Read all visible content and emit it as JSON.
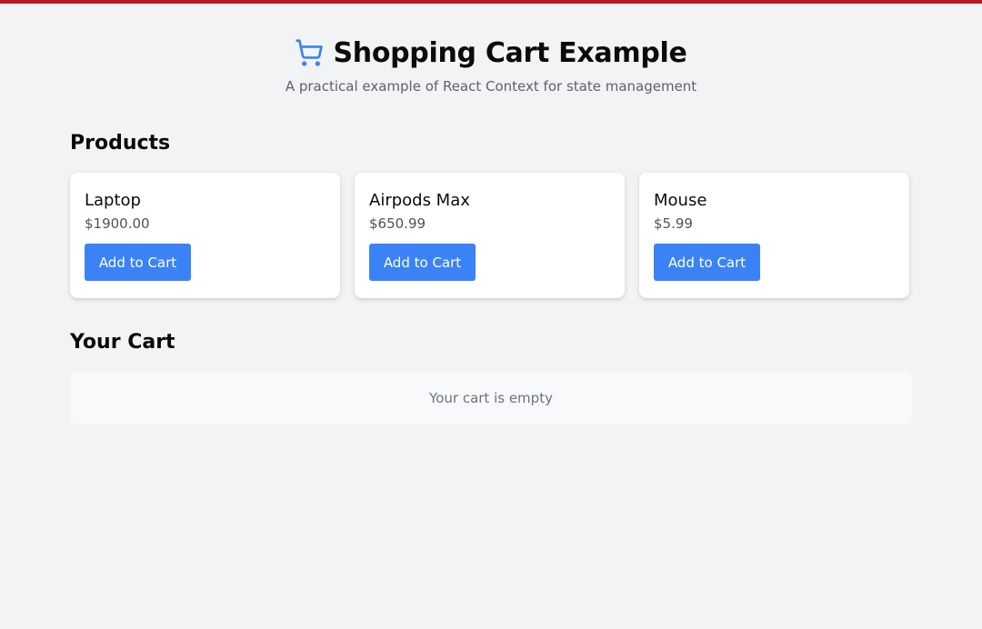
{
  "header": {
    "title": "Shopping Cart Example",
    "subtitle": "A practical example of React Context for state management",
    "icon": "shopping-cart-icon"
  },
  "products_section": {
    "title": "Products",
    "items": [
      {
        "name": "Laptop",
        "price": "$1900.00",
        "button_label": "Add to Cart"
      },
      {
        "name": "Airpods Max",
        "price": "$650.99",
        "button_label": "Add to Cart"
      },
      {
        "name": "Mouse",
        "price": "$5.99",
        "button_label": "Add to Cart"
      }
    ]
  },
  "cart_section": {
    "title": "Your Cart",
    "empty_message": "Your cart is empty"
  },
  "colors": {
    "top_bar": "#b91c1c",
    "accent": "#3b82f6",
    "background": "#f2f3f5"
  }
}
